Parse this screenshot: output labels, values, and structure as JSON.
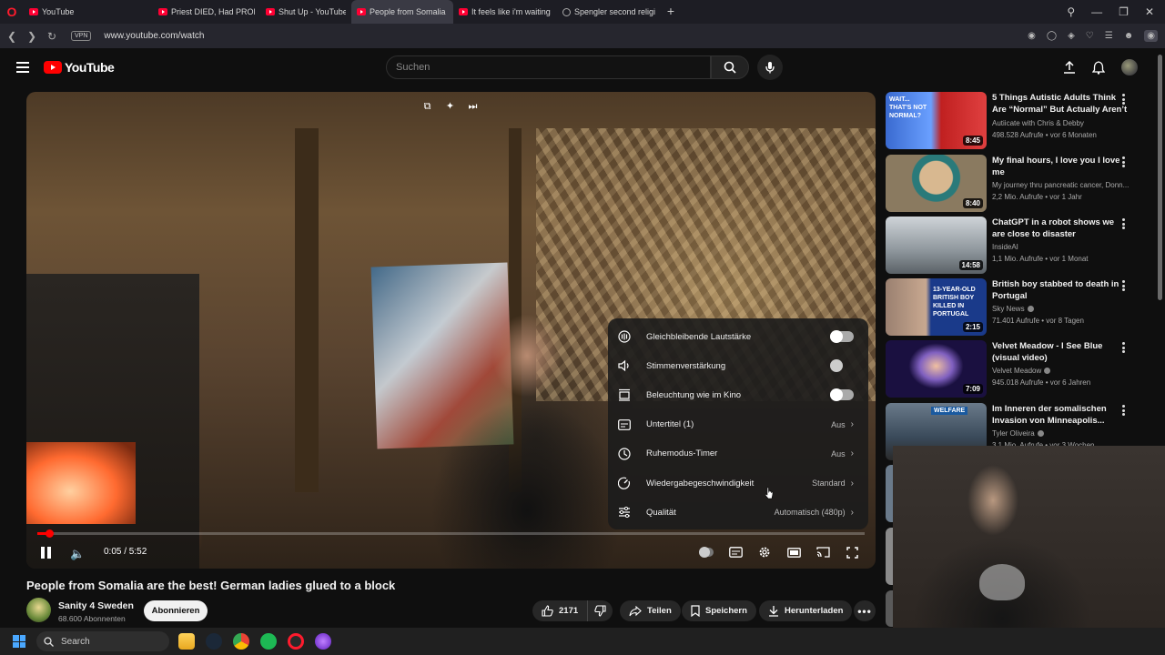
{
  "browser": {
    "tabs": [
      {
        "title": "YouTube",
        "favicon": "youtube-icon",
        "active": false
      },
      {
        "title": "Priest DIED, Had PROFOUND",
        "favicon": "youtube-icon",
        "active": false
      },
      {
        "title": "Shut Up - YouTube",
        "favicon": "youtube-icon",
        "active": false
      },
      {
        "title": "People from Somalia",
        "favicon": "youtube-icon",
        "active": true
      },
      {
        "title": "It feels like i'm waiting to",
        "favicon": "youtube-icon",
        "active": false
      },
      {
        "title": "Spengler second religious",
        "favicon": "globe-icon",
        "active": false
      }
    ],
    "vpn_label": "VPN",
    "url": "www.youtube.com/watch"
  },
  "header": {
    "logo_text": "YouTube",
    "search_placeholder": "Suchen"
  },
  "player": {
    "time": "0:05 / 5:52",
    "progress_fraction": 0.014,
    "loaded_fraction": 0.06
  },
  "settings": {
    "items": [
      {
        "label": "Gleichbleibende Lautstärke",
        "icon": "stable-volume-icon",
        "type": "toggle",
        "on": true
      },
      {
        "label": "Stimmenverstärkung",
        "icon": "voice-boost-icon",
        "type": "toggle",
        "on": false
      },
      {
        "label": "Beleuchtung wie im Kino",
        "icon": "ambient-mode-icon",
        "type": "toggle",
        "on": true
      },
      {
        "label": "Untertitel (1)",
        "icon": "subtitles-icon",
        "type": "value",
        "value": "Aus"
      },
      {
        "label": "Ruhemodus-Timer",
        "icon": "sleep-timer-icon",
        "type": "value",
        "value": "Aus"
      },
      {
        "label": "Wiedergabegeschwindigkeit",
        "icon": "playback-speed-icon",
        "type": "value",
        "value": "Standard"
      },
      {
        "label": "Qualität",
        "icon": "quality-icon",
        "type": "value",
        "value": "Automatisch (480p)"
      }
    ]
  },
  "video": {
    "title": "People from Somalia are the best! German ladies glued to a block",
    "channel": "Sanity 4 Sweden",
    "subscribers": "68.600 Abonnenten",
    "subscribe_label": "Abonnieren",
    "likes": "2171",
    "share_label": "Teilen",
    "save_label": "Speichern",
    "download_label": "Herunterladen"
  },
  "sidebar": {
    "items": [
      {
        "title": "5 Things Autistic Adults Think Are “Normal” But Actually Aren’t",
        "channel": "Autiicate with Chris & Debby",
        "meta": "498.528 Aufrufe • vor 6 Monaten",
        "duration": "8:45",
        "verified": false,
        "thumb_text": "WAIT... THAT'S NOT NORMAL?"
      },
      {
        "title": "My final hours, I love you I love me",
        "channel": "My journey thru pancreatic cancer, Donn...",
        "meta": "2,2 Mio. Aufrufe • vor 1 Jahr",
        "duration": "8:40",
        "verified": false,
        "thumb_text": ""
      },
      {
        "title": "ChatGPT in a robot shows we are close to disaster",
        "channel": "InsideAI",
        "meta": "1,1 Mio. Aufrufe • vor 1 Monat",
        "duration": "14:58",
        "verified": false,
        "thumb_text": ""
      },
      {
        "title": "British boy stabbed to death in Portugal",
        "channel": "Sky News",
        "meta": "71.401 Aufrufe • vor 8 Tagen",
        "duration": "2:15",
        "verified": true,
        "thumb_text": "13-YEAR-OLD BRITISH BOY KILLED IN PORTUGAL"
      },
      {
        "title": "Velvet Meadow - I See Blue (visual video)",
        "channel": "Velvet Meadow",
        "meta": "945.018 Aufrufe • vor 6 Jahren",
        "duration": "7:09",
        "verified": true,
        "thumb_text": ""
      },
      {
        "title": "Im Inneren der somalischen Invasion von Minneapolis...",
        "channel": "Tyler Oliveira",
        "meta": "3,1 Mio. Aufrufe • vor 3 Wochen",
        "duration": "",
        "verified": true,
        "thumb_text": "WELFARE"
      }
    ]
  },
  "taskbar": {
    "search_label": "Search"
  },
  "colors": {
    "accent": "#ff0000",
    "background": "#0f0f0f"
  }
}
